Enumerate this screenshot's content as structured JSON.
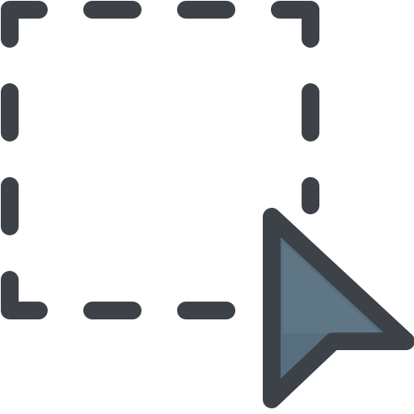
{
  "icon": {
    "name": "select-area-icon",
    "colors": {
      "stroke": "#3c4248",
      "cursor_fill": "#566e7d",
      "highlight": "#ffffff"
    },
    "parts": [
      "selection-marquee",
      "cursor-arrow"
    ]
  }
}
